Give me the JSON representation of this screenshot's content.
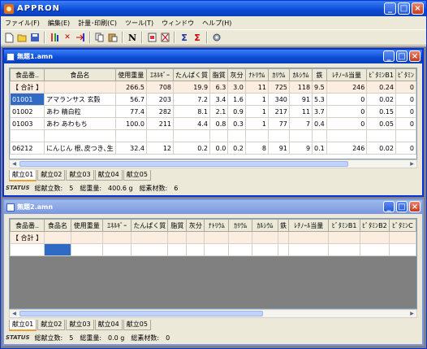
{
  "app": {
    "title": "APPRON"
  },
  "menu": [
    "ファイル(F)",
    "編集(E)",
    "計量･印刷(C)",
    "ツール(T)",
    "ウィンドウ",
    "ヘルプ(H)"
  ],
  "toolbar_icons": [
    "new-icon",
    "open-icon",
    "save-icon",
    "tuning-icon",
    "delete-icon",
    "insert-row-icon",
    "copy-icon",
    "paste-icon",
    "n-icon",
    "report-icon",
    "clear-icon",
    "sum-icon",
    "sum-red-icon",
    "settings-icon"
  ],
  "doc1": {
    "title": "無題1.amn",
    "headers": [
      "食品番..",
      "食品名",
      "使用重量",
      "ｴﾈﾙｷﾞｰ",
      "たんぱく質",
      "脂質",
      "灰分",
      "ﾅﾄﾘｳﾑ",
      "ｶﾘｳﾑ",
      "ｶﾙｼｳﾑ",
      "鉄",
      "ﾚﾁﾉｰﾙ当量",
      "ﾋﾞﾀﾐﾝB1",
      "ﾋﾞﾀﾐﾝ"
    ],
    "summary": [
      "【 合計 】",
      "",
      "266.5",
      "708",
      "19.9",
      "6.3",
      "3.0",
      "11",
      "725",
      "118",
      "9.5",
      "246",
      "0.24",
      "0"
    ],
    "rows": [
      [
        "01001",
        "アマランサス 玄穀",
        "56.7",
        "203",
        "7.2",
        "3.4",
        "1.6",
        "1",
        "340",
        "91",
        "5.3",
        "0",
        "0.02",
        "0"
      ],
      [
        "01002",
        "あわ 精白粒",
        "77.4",
        "282",
        "8.1",
        "2.1",
        "0.9",
        "1",
        "217",
        "11",
        "3.7",
        "0",
        "0.15",
        "0"
      ],
      [
        "01003",
        "あわ あわもち",
        "100.0",
        "211",
        "4.4",
        "0.8",
        "0.3",
        "1",
        "77",
        "7",
        "0.4",
        "0",
        "0.05",
        "0"
      ],
      [
        "",
        "",
        "",
        "",
        "",
        "",
        "",
        "",
        "",
        "",
        "",
        "",
        "",
        ""
      ],
      [
        "06212",
        "にんじん 根､皮つき､生",
        "32.4",
        "12",
        "0.2",
        "0.0",
        "0.2",
        "8",
        "91",
        "9",
        "0.1",
        "246",
        "0.02",
        "0"
      ]
    ],
    "tabs": [
      "献立01",
      "献立02",
      "献立03",
      "献立04",
      "献立05"
    ],
    "status": {
      "label": "STATUS",
      "count_label": "総献立数:",
      "count": "5",
      "weight_label": "総重量:",
      "weight": "400.6 g",
      "items_label": "総素材数:",
      "items": "6"
    }
  },
  "doc2": {
    "title": "無題2.amn",
    "headers": [
      "食品番..",
      "食品名",
      "使用重量",
      "ｴﾈﾙｷﾞｰ",
      "たんぱく質",
      "脂質",
      "灰分",
      "ﾅﾄﾘｳﾑ",
      "ｶﾘｳﾑ",
      "ｶﾙｼｳﾑ",
      "鉄",
      "ﾚﾁﾉｰﾙ当量",
      "ﾋﾞﾀﾐﾝB1",
      "ﾋﾞﾀﾐﾝB2",
      "ﾋﾞﾀﾐﾝC"
    ],
    "summary": [
      "【 合計 】",
      "",
      "",
      "",
      "",
      "",
      "",
      "",
      "",
      "",
      "",
      "",
      "",
      "",
      ""
    ],
    "tabs": [
      "献立01",
      "献立02",
      "献立03",
      "献立04",
      "献立05"
    ],
    "status": {
      "label": "STATUS",
      "count_label": "総献立数:",
      "count": "5",
      "weight_label": "総重量:",
      "weight": "0.0 g",
      "items_label": "総素材数:",
      "items": "0"
    }
  }
}
